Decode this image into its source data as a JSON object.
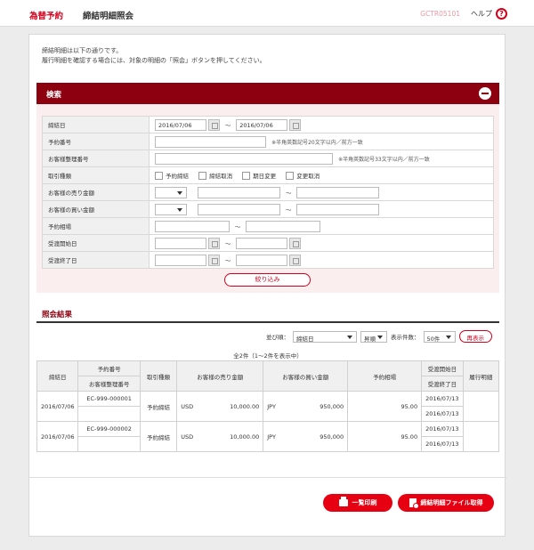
{
  "header": {
    "brand": "為替予約",
    "title": "締結明細照会",
    "screen_id": "GCTR05101",
    "help_label": "ヘルプ",
    "help_icon_glyph": "?"
  },
  "intro": {
    "line1": "締結明細は以下の通りです。",
    "line2": "履行明細を確認する場合には、対象の明細の「照会」ボタンを押してください。"
  },
  "search": {
    "title": "検索",
    "tilde": "〜",
    "fields": {
      "contract_date": {
        "label": "締結日",
        "from": "2016/07/06",
        "to": "2016/07/06"
      },
      "reservation_no": {
        "label": "予約番号",
        "note": "※半角英数記号20文字以内／前方一致"
      },
      "customer_ref": {
        "label": "お客様整理番号",
        "note": "※半角英数記号33文字以内／前方一致"
      },
      "trade_type": {
        "label": "取引種類",
        "options": [
          "予約締結",
          "締結取消",
          "期日変更",
          "変更取消"
        ]
      },
      "sell_amount": {
        "label": "お客様の売り金額"
      },
      "buy_amount": {
        "label": "お客様の買い金額"
      },
      "rate": {
        "label": "予約相場"
      },
      "delivery_start": {
        "label": "受渡開始日"
      },
      "delivery_end": {
        "label": "受渡終了日"
      }
    },
    "narrow_button": "絞り込み"
  },
  "results": {
    "title": "照会結果",
    "sort_label": "並び順：",
    "sort_key": "締結日",
    "sort_order": "昇順",
    "page_size_label": "表示件数：",
    "page_size": "50件",
    "redisplay_button": "再表示",
    "count_text": "全2件（1〜2件を表示中）",
    "headers": {
      "contract_date": "締結日",
      "reservation_no": "予約番号",
      "customer_ref": "お客様整理番号",
      "trade_type": "取引種類",
      "sell_amount": "お客様の売り金額",
      "buy_amount": "お客様の買い金額",
      "rate": "予約相場",
      "delivery_start": "受渡開始日",
      "delivery_end": "受渡終了日",
      "exec_detail": "履行明細"
    },
    "rows": [
      {
        "contract_date": "2016/07/06",
        "reservation_no": "EC-999-000001",
        "trade_type": "予約締結",
        "sell_ccy": "USD",
        "sell_amount": "10,000.00",
        "buy_ccy": "JPY",
        "buy_amount": "950,000",
        "rate": "95.00",
        "delivery_start": "2016/07/13",
        "delivery_end": "2016/07/13"
      },
      {
        "contract_date": "2016/07/06",
        "reservation_no": "EC-999-000002",
        "trade_type": "予約締結",
        "sell_ccy": "USD",
        "sell_amount": "10,000.00",
        "buy_ccy": "JPY",
        "buy_amount": "950,000",
        "rate": "95.00",
        "delivery_start": "2016/07/13",
        "delivery_end": "2016/07/13"
      }
    ]
  },
  "footer": {
    "print_button": "一覧印刷",
    "download_button": "締結明細ファイル取得"
  },
  "colors": {
    "brand_red": "#d2001c",
    "header_dark_red": "#8c0010",
    "button_red": "#e60012"
  }
}
